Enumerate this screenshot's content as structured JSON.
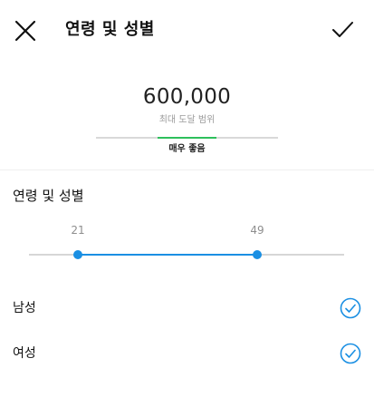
{
  "colors": {
    "accent": "#1a8fe3",
    "quality_green": "#2ec05c",
    "track": "#d6d6d6"
  },
  "header": {
    "title": "연령 및 성별",
    "close_icon": "close-icon",
    "confirm_icon": "checkmark-icon"
  },
  "reach": {
    "value": "600,000",
    "label": "최대 도달 범위",
    "quality_text": "매우 좋음"
  },
  "age_gender": {
    "title": "연령 및 성별",
    "age_min": "21",
    "age_max": "49"
  },
  "genders": [
    {
      "label": "남성",
      "checked": true,
      "icon": "check-circle-icon"
    },
    {
      "label": "여성",
      "checked": true,
      "icon": "check-circle-icon"
    }
  ]
}
